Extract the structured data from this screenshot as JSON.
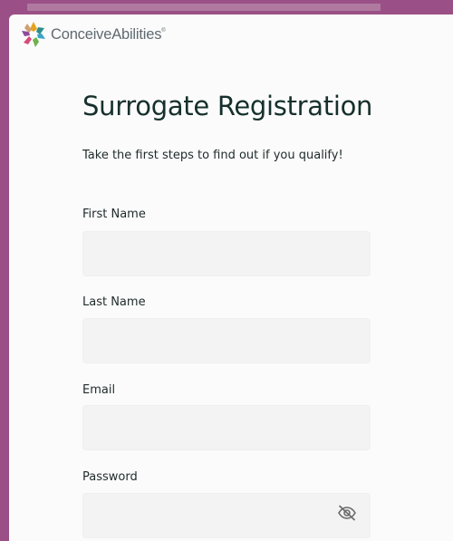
{
  "brand": {
    "name": "ConceiveAbilities",
    "trademark": "®",
    "logo_icon": "conceiveabilities-logo-icon"
  },
  "page": {
    "title": "Surrogate Registration",
    "subtitle": "Take the first steps to find out if you qualify!"
  },
  "form": {
    "first_name": {
      "label": "First Name",
      "value": ""
    },
    "last_name": {
      "label": "Last Name",
      "value": ""
    },
    "email": {
      "label": "Email",
      "value": ""
    },
    "password": {
      "label": "Password",
      "value": "",
      "toggle_icon": "eye-off-icon"
    }
  },
  "colors": {
    "frame": "#9a5086",
    "card": "#fbfbfb",
    "title": "#16302c",
    "input_bg": "#f3f3f3"
  }
}
